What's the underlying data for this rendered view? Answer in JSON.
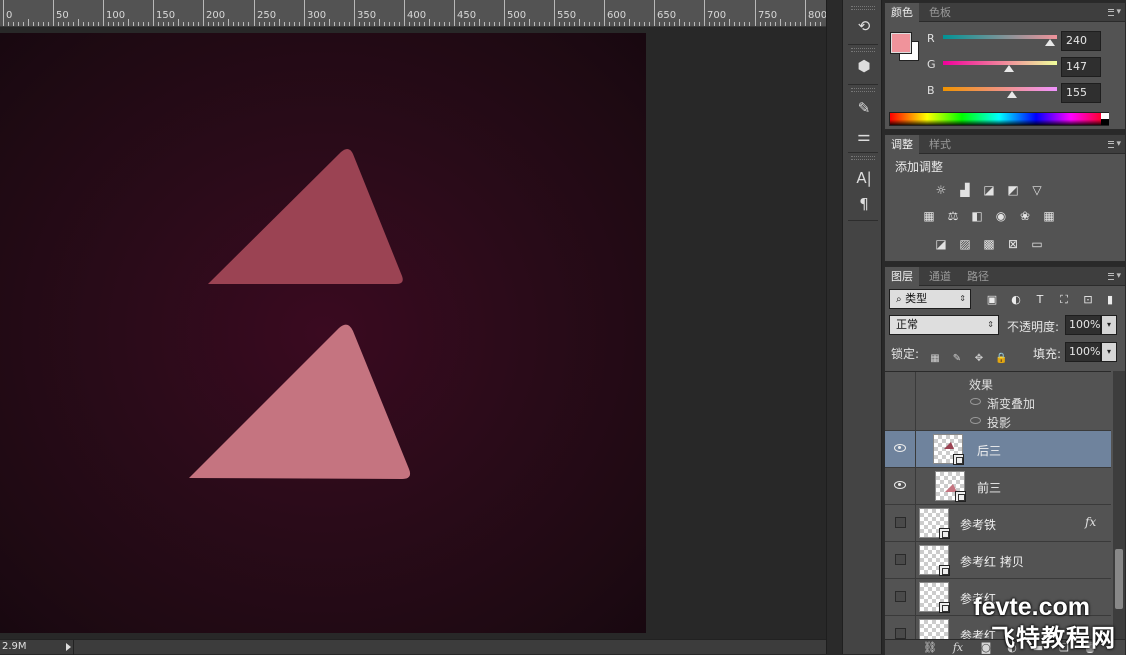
{
  "ruler": {
    "ticks": [
      "0",
      "50",
      "100",
      "150",
      "200",
      "250",
      "300",
      "350",
      "400",
      "450",
      "500",
      "550",
      "600",
      "650",
      "700",
      "750",
      "800"
    ]
  },
  "canvas": {
    "background_colors": [
      "#3a0a20",
      "#180810"
    ],
    "triangle_top_color": "#9b4353",
    "triangle_bottom_color": "#c57480"
  },
  "statusbar": {
    "doc_size": "2.9M"
  },
  "color_panel": {
    "tabs": [
      "颜色",
      "色板"
    ],
    "foreground": "#f0939b",
    "background": "#ffffff",
    "channels": [
      {
        "label": "R",
        "value": "240",
        "level": 0.941
      },
      {
        "label": "G",
        "value": "147",
        "level": 0.576
      },
      {
        "label": "B",
        "value": "155",
        "level": 0.608
      }
    ]
  },
  "adjustments_panel": {
    "tabs": [
      "调整",
      "样式"
    ],
    "title": "添加调整",
    "icons": [
      [
        "brightness-contrast-icon",
        "levels-icon",
        "curves-icon",
        "exposure-icon",
        "vibrance-icon"
      ],
      [
        "hue-saturation-icon",
        "color-balance-icon",
        "black-white-icon",
        "photo-filter-icon",
        "channel-mixer-icon",
        "color-lookup-icon"
      ],
      [
        "invert-icon",
        "posterize-icon",
        "threshold-icon",
        "selective-color-icon",
        "gradient-map-icon"
      ]
    ]
  },
  "layers_panel": {
    "tabs": [
      "图层",
      "通道",
      "路径"
    ],
    "filter_kind": "类型",
    "blend_mode": "正常",
    "opacity_label": "不透明度:",
    "opacity_value": "100%",
    "lock_label": "锁定:",
    "fill_label": "填充:",
    "fill_value": "100%",
    "effects_header": "效果",
    "effects": [
      "渐变叠加",
      "投影"
    ],
    "layers": [
      {
        "name": "后三",
        "visible": true,
        "selected": true,
        "fx": false
      },
      {
        "name": "前三",
        "visible": true,
        "selected": false,
        "fx": false
      },
      {
        "name": "参考铁",
        "visible": false,
        "selected": false,
        "fx": true
      },
      {
        "name": "参考红 拷贝",
        "visible": false,
        "selected": false,
        "fx": false
      },
      {
        "name": "参考红",
        "visible": false,
        "selected": false,
        "fx": false
      },
      {
        "name": "参考红",
        "visible": false,
        "selected": false,
        "fx": false
      }
    ],
    "fx_label": "fx"
  },
  "watermark": {
    "line1": "fevte.com",
    "line2": "飞特教程网"
  }
}
